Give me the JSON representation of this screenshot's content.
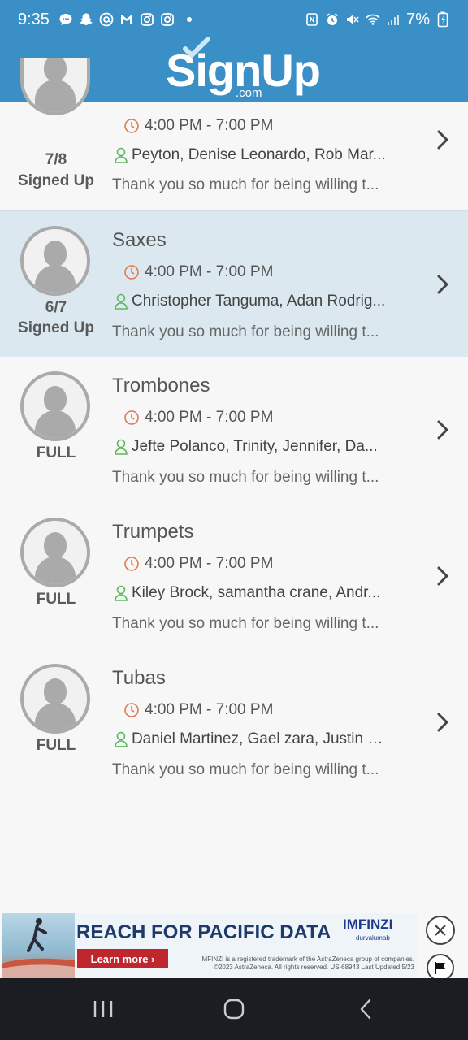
{
  "status_bar": {
    "time": "9:35",
    "battery": "7%",
    "left_icons": [
      "messages-icon",
      "snapchat-icon",
      "threads-icon",
      "gmail-icon",
      "instagram-icon",
      "instagram-icon",
      "dot-icon"
    ],
    "right_icons": [
      "nfc-icon",
      "alarm-icon",
      "mute-icon",
      "wifi-icon",
      "signal-icon",
      "battery-icon"
    ]
  },
  "header": {
    "logo_main": "SignUp",
    "logo_sub": ".com",
    "back_icon": "chevron-left-icon"
  },
  "slots": [
    {
      "title": "",
      "count": "7/8",
      "status": "Signed Up",
      "time": "4:00 PM - 7:00 PM",
      "names": "Peyton, Denise Leonardo, Rob Mar...",
      "description": "Thank you so much for being willing t...",
      "highlight": false
    },
    {
      "title": "Saxes",
      "count": "6/7",
      "status": "Signed Up",
      "time": "4:00 PM - 7:00 PM",
      "names": "Christopher Tanguma, Adan Rodrig...",
      "description": "Thank you so much for being willing t...",
      "highlight": true
    },
    {
      "title": "Trombones",
      "count": "",
      "status": "FULL",
      "time": "4:00 PM - 7:00 PM",
      "names": "Jefte Polanco, Trinity, Jennifer, Da...",
      "description": "Thank you so much for being willing t...",
      "highlight": false
    },
    {
      "title": "Trumpets",
      "count": "",
      "status": "FULL",
      "time": "4:00 PM - 7:00 PM",
      "names": "Kiley Brock, samantha crane, Andr...",
      "description": "Thank you so much for being willing t...",
      "highlight": false
    },
    {
      "title": "Tubas",
      "count": "",
      "status": "FULL",
      "time": "4:00 PM - 7:00 PM",
      "names": "Daniel Martinez, Gael zara, Justin E...",
      "description": "Thank you so much for being willing t...",
      "highlight": false
    }
  ],
  "ad": {
    "title": "REACH FOR PACIFIC DATA",
    "button": "Learn more ›",
    "brand": "IMFINZI",
    "brand_sub": "durvalumab",
    "fine_print": "IMFINZI is a registered trademark of the AstraZeneca group of companies. ©2023 AstraZeneca. All rights reserved. US-68943 Last Updated 5/23"
  },
  "colors": {
    "header_blue": "#3a8fc6",
    "clock_orange": "#e07a4f",
    "person_green": "#5cb85c",
    "highlight_row": "#dbe8ef"
  }
}
